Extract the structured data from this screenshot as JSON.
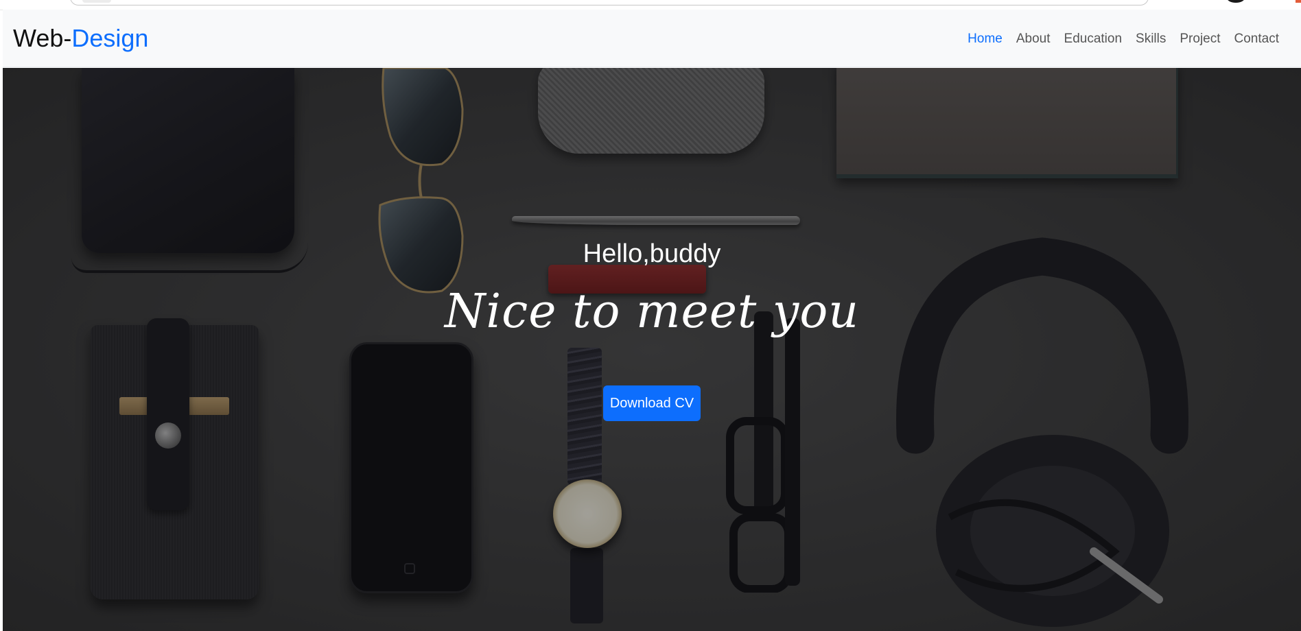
{
  "navbar": {
    "brand": {
      "part1": "Web-",
      "part2": "Design"
    },
    "links": [
      {
        "label": "Home",
        "active": true
      },
      {
        "label": "About",
        "active": false
      },
      {
        "label": "Education",
        "active": false
      },
      {
        "label": "Skills",
        "active": false
      },
      {
        "label": "Project",
        "active": false
      },
      {
        "label": "Contact",
        "active": false
      }
    ]
  },
  "hero": {
    "greeting": "Hello,buddy",
    "tagline": "Nice to meet you",
    "cta_label": "Download CV"
  },
  "colors": {
    "accent": "#0d6efd",
    "navbar_bg": "#f8f9fa",
    "nav_link": "#555555",
    "hero_text": "#ffffff"
  }
}
